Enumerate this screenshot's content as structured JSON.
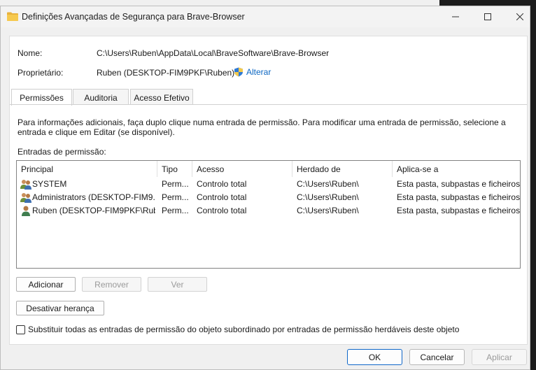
{
  "window": {
    "title": "Definições Avançadas de Segurança para Brave-Browser"
  },
  "details": {
    "name_label": "Nome:",
    "name_value": "C:\\Users\\Ruben\\AppData\\Local\\BraveSoftware\\Brave-Browser",
    "owner_label": "Proprietário:",
    "owner_value": "Ruben (DESKTOP-FIM9PKF\\Ruben)",
    "change_link": "Alterar"
  },
  "tabs": [
    {
      "label": "Permissões",
      "active": true
    },
    {
      "label": "Auditoria",
      "active": false
    },
    {
      "label": "Acesso Efetivo",
      "active": false
    }
  ],
  "info_text": "Para informações adicionais, faça duplo clique numa entrada de permissão. Para modificar uma entrada de permissão, selecione a entrada e clique em Editar (se disponível).",
  "entries_label": "Entradas de permissão:",
  "table": {
    "columns": [
      "Principal",
      "Tipo",
      "Acesso",
      "Herdado de",
      "Aplica-se a"
    ],
    "rows": [
      {
        "principal": "SYSTEM",
        "tipo": "Perm...",
        "acesso": "Controlo total",
        "herdado": "C:\\Users\\Ruben\\",
        "aplica": "Esta pasta, subpastas e ficheiros",
        "icon": "group-users-icon"
      },
      {
        "principal": "Administrators (DESKTOP-FIM9...",
        "tipo": "Perm...",
        "acesso": "Controlo total",
        "herdado": "C:\\Users\\Ruben\\",
        "aplica": "Esta pasta, subpastas e ficheiros",
        "icon": "group-users-icon"
      },
      {
        "principal": "Ruben (DESKTOP-FIM9PKF\\Rub...",
        "tipo": "Perm...",
        "acesso": "Controlo total",
        "herdado": "C:\\Users\\Ruben\\",
        "aplica": "Esta pasta, subpastas e ficheiros",
        "icon": "single-user-icon"
      }
    ]
  },
  "buttons": {
    "add": "Adicionar",
    "remove": "Remover",
    "view": "Ver",
    "disable_inheritance": "Desativar herança"
  },
  "replace_checkbox_label": "Substituir todas as entradas de permissão do objeto subordinado por entradas de permissão herdáveis deste objeto",
  "footer": {
    "ok": "OK",
    "cancel": "Cancelar",
    "apply": "Aplicar"
  }
}
